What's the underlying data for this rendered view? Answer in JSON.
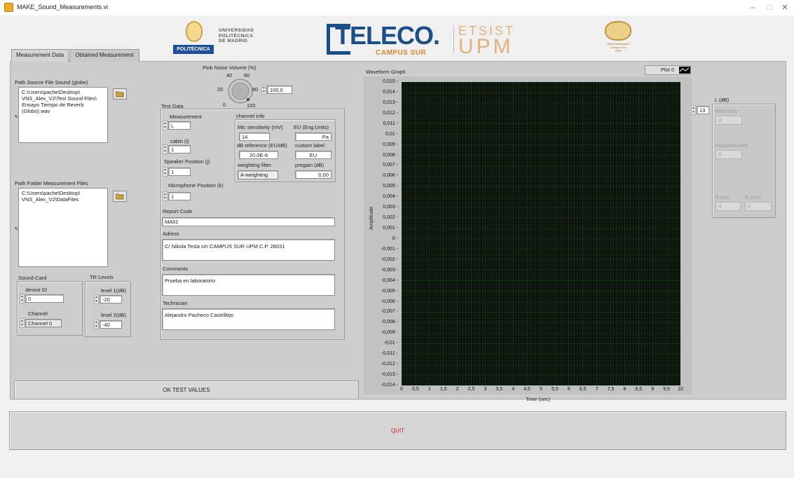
{
  "window": {
    "title": "MAKE_Sound_Measurements.vi",
    "minimize": "–",
    "maximize": "□",
    "close": "✕"
  },
  "logos": {
    "upm_bar": "POLITÉCNICA",
    "upm_text": "UNIVERSIDAD\nPOLITÉCNICA\nDE MADRID",
    "teleco": "TELECO.",
    "campus": "CAMPUS SUR",
    "etsist": "ETSIST",
    "upm": "UPM",
    "crest_banner": "Telecomunicación\nCampus Sur\nUPM"
  },
  "tabs": [
    {
      "label": "Measurement Data",
      "active": true
    },
    {
      "label": "Obtained Measurement",
      "active": false
    }
  ],
  "source": {
    "label": "Path Source File Sound (globe)",
    "path": "C:\\Users\\pache\\Desktop\\\nVNS_Alex_V2\\Test Sound Files\\\nEnsayo Tiempo de Reverb\n(Globo).wav"
  },
  "folder": {
    "label": "Path Folder Measurement Files",
    "path": "C:\\Users\\pache\\Desktop\\\nVNS_Alex_V2\\DataFiles"
  },
  "soundcard": {
    "label": "Sound-Card",
    "device_label": "device ID",
    "device_value": "0",
    "channel_label": "Channel",
    "channel_value": "Channel 0"
  },
  "tr_levels": {
    "label": "TR Levels",
    "level1_label": "level 1(dB)",
    "level1_value": "-20",
    "level2_label": "level 2(dB)",
    "level2_value": "-40"
  },
  "pink_noise": {
    "label": "Pink Noise Volume (%)",
    "t0": "0",
    "t20": "20",
    "t40": "40",
    "t60": "60",
    "t80": "80",
    "t100": "100",
    "value": "100,0"
  },
  "test_data": {
    "label": "Test Data",
    "measurement_label": "Measurement",
    "measurement_value": "L",
    "cabin_label": "cabin (i)",
    "cabin_value": "1",
    "speaker_label": "Speaker Position (j)",
    "speaker_value": "1",
    "mic_label": "Microphone Position (k)",
    "mic_value": "1",
    "channel_info": "channel info",
    "mic_sens_label": "Mic sensitivity (mV)",
    "mic_sens_value": "14",
    "eu_label": "EU (Eng.Units)",
    "eu_value": "Pa",
    "dbref_label": "dB reference (EU/dB)",
    "dbref_value": "20,0E-6",
    "custom_label": "custom label",
    "custom_value": "EU",
    "weighting_label": "weighting filter",
    "weighting_value": "A-weighting",
    "pregain_label": "pregain (dB)",
    "pregain_value": "0,00",
    "report_label": "Report Code",
    "report_value": "MA01",
    "address_label": "Adress",
    "address_value": "C/ Nikola Tesla s/n CAMPUS SUR UPM C.P. 28031",
    "comments_label": "Comments",
    "comments_value": "Prueba en laboratorio",
    "technician_label": "Technician",
    "technician_value": "Alejandro Pacheco Castrillejo"
  },
  "graph": {
    "title": "Waveform Graph",
    "legend": "Plot 0"
  },
  "chart_data": {
    "type": "line",
    "title": "Waveform Graph",
    "xlabel": "Time (sec)",
    "ylabel": "Amplitude",
    "xlim": [
      0,
      10
    ],
    "ylim": [
      -0.014,
      0.015
    ],
    "grid": true,
    "series": [
      {
        "name": "Plot 0",
        "x": [],
        "values": []
      }
    ],
    "x_ticks": [
      "0",
      "0,5",
      "1",
      "1,5",
      "2",
      "2,5",
      "3",
      "3,5",
      "4",
      "4,5",
      "5",
      "5,5",
      "6",
      "6,5",
      "7",
      "7,5",
      "8",
      "8,5",
      "9",
      "9,5",
      "10"
    ],
    "y_ticks": [
      "0,015",
      "0,014",
      "0,013",
      "0,012",
      "0,011",
      "0,01",
      "0,009",
      "0,008",
      "0,007",
      "0,006",
      "0,005",
      "0,004",
      "0,003",
      "0,002",
      "0,001",
      "0",
      "-0,001",
      "-0,002",
      "-0,003",
      "-0,004",
      "-0,005",
      "-0,006",
      "-0,007",
      "-0,008",
      "-0,009",
      "-0,01",
      "-0,011",
      "-0,012",
      "-0,013",
      "-0,014"
    ]
  },
  "l_panel": {
    "label": "L (dB)",
    "index": "13",
    "fmid_label": "fmid (Hz)",
    "fmid_value": "0",
    "measurement_label": "Measurement",
    "measurement_value": "0",
    "fl_label": "fl (Hz)",
    "fl_value": "0",
    "fh_label": "fh (Hz)",
    "fh_value": "0"
  },
  "buttons": {
    "ok": "OK TEST VALUES",
    "quit": "QUIT"
  }
}
